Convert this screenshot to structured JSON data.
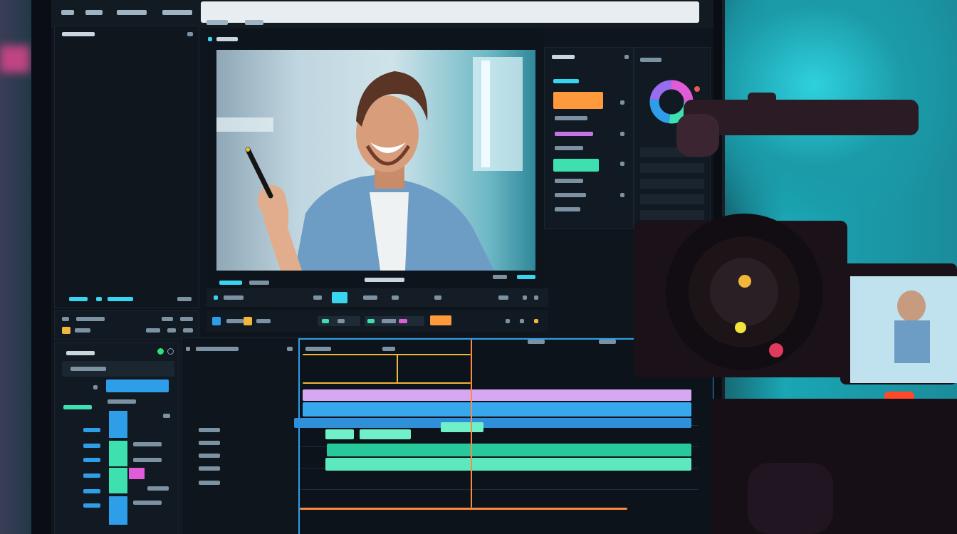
{
  "app": {
    "preview_caption": "",
    "left_panel_label": "",
    "colors": {
      "accent_cyan": "#38d4f0",
      "accent_orange": "#ff9a3c",
      "accent_purple": "#c8a4f0",
      "accent_blue": "#2f9ee8",
      "accent_green": "#3fe0b0",
      "accent_magenta": "#e05bd8",
      "playhead": "#ff8a3c"
    },
    "icons": {
      "donut_chart": "color-wheel-icon",
      "play": "play-icon",
      "settings": "gear-icon"
    }
  },
  "timeline": {
    "track_count": 5
  }
}
